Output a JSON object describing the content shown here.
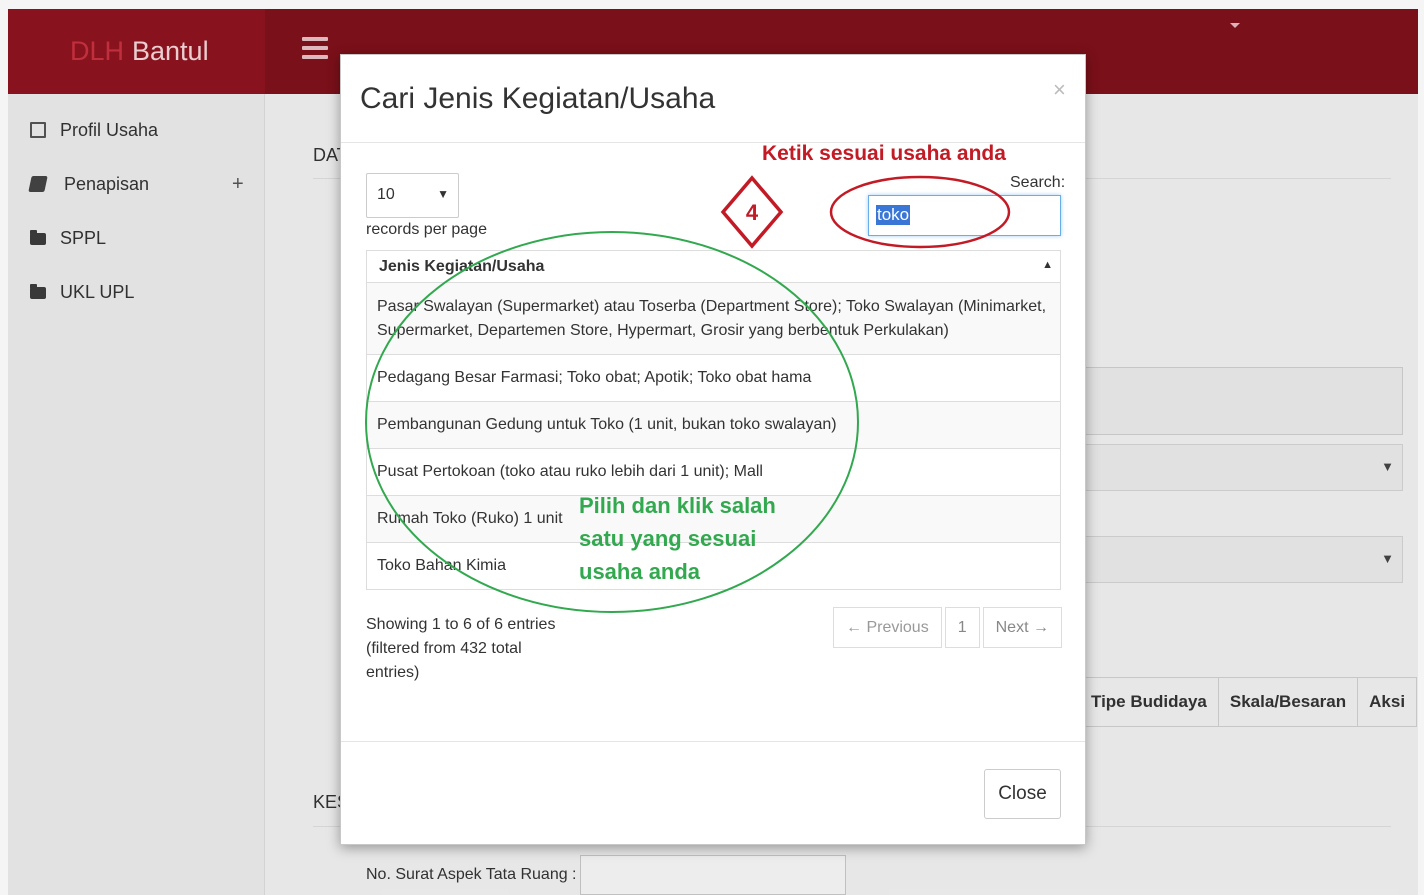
{
  "app": {
    "brand_prefix": "DLH",
    "brand_name": "Bantul"
  },
  "sidebar": {
    "items": [
      {
        "label": "Profil Usaha",
        "icon": "document-icon"
      },
      {
        "label": "Penapisan",
        "icon": "book-icon",
        "expander": "+"
      },
      {
        "label": "SPPL",
        "icon": "folder-icon"
      },
      {
        "label": "UKL UPL",
        "icon": "folder-icon"
      }
    ]
  },
  "background": {
    "section_heading_1": "DAT",
    "section_heading_2": "KES",
    "table_headers": [
      "Tipe Budidaya",
      "Skala/Besaran",
      "Aksi"
    ],
    "field_label": "No. Surat Aspek Tata Ruang :"
  },
  "modal": {
    "title": "Cari Jenis Kegiatan/Usaha",
    "close_x": "×",
    "length_value": "10",
    "records_label": "records per page",
    "search_label": "Search:",
    "search_value": "toko",
    "column_header": "Jenis Kegiatan/Usaha",
    "rows": [
      "Pasar Swalayan (Supermarket) atau Toserba (Department Store); Toko Swalayan (Minimarket, Supermarket, Departemen Store, Hypermart, Grosir yang berbentuk Perkulakan)",
      "Pedagang Besar Farmasi; Toko obat; Apotik; Toko obat hama",
      "Pembangunan Gedung untuk Toko (1 unit, bukan toko swalayan)",
      "Pusat Pertokoan (toko atau ruko lebih dari 1 unit); Mall",
      "Rumah Toko (Ruko) 1 unit",
      "Toko Bahan Kimia"
    ],
    "info_text": "Showing 1 to 6 of 6 entries (filtered from 432 total entries)",
    "pagination": {
      "previous": "← Previous",
      "current": "1",
      "next": "Next →"
    },
    "close_button": "Close"
  },
  "annotations": {
    "red_caption": "Ketik sesuai usaha anda",
    "step_number": "4",
    "green_caption_lines": [
      "Pilih dan klik salah",
      "satu yang sesuai",
      "usaha anda"
    ],
    "red_color": "#c21b25",
    "green_color": "#32a84f"
  },
  "colors": {
    "topbar": "#7f111b",
    "brand_bg": "#8e1420",
    "focus": "#66afe9"
  }
}
